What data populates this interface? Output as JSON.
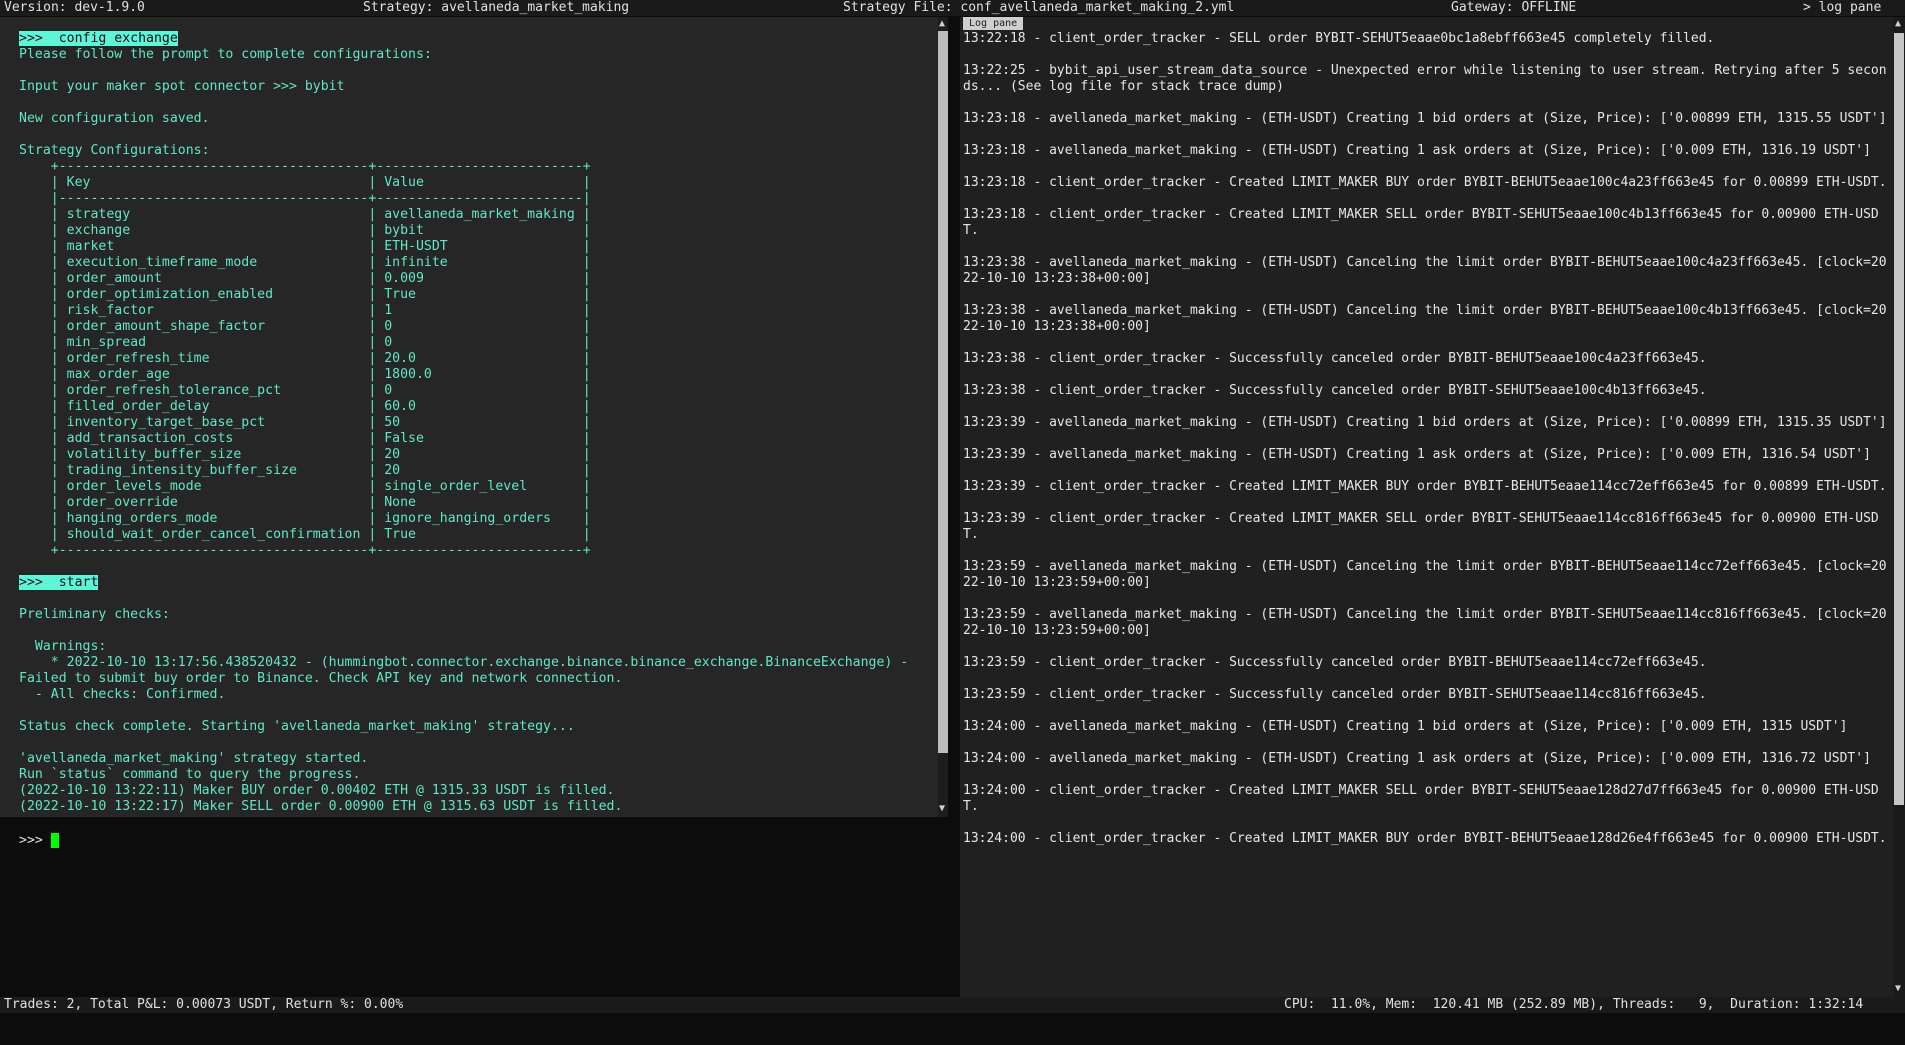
{
  "top_bar": {
    "version": "Version: dev-1.9.0",
    "strategy": "Strategy: avellaneda_market_making",
    "strategy_file": "Strategy File: conf_avellaneda_market_making_2.yml",
    "gateway": "Gateway: OFFLINE",
    "log_pane": "> log pane"
  },
  "output": [
    {
      "text": ">>>  config exchange",
      "cmd": true
    },
    {
      "text": "Please follow the prompt to complete configurations:"
    },
    {
      "text": ""
    },
    {
      "text": "Input your maker spot connector >>> bybit"
    },
    {
      "text": ""
    },
    {
      "text": "New configuration saved."
    },
    {
      "text": ""
    },
    {
      "text": "Strategy Configurations:"
    },
    {
      "text": "    +---------------------------------------+--------------------------+"
    },
    {
      "text": "    | Key                                   | Value                    |"
    },
    {
      "text": "    |---------------------------------------+--------------------------|"
    },
    {
      "text": "    | strategy                              | avellaneda_market_making |"
    },
    {
      "text": "    | exchange                              | bybit                    |"
    },
    {
      "text": "    | market                                | ETH-USDT                 |"
    },
    {
      "text": "    | execution_timeframe_mode              | infinite                 |"
    },
    {
      "text": "    | order_amount                          | 0.009                    |"
    },
    {
      "text": "    | order_optimization_enabled            | True                     |"
    },
    {
      "text": "    | risk_factor                           | 1                        |"
    },
    {
      "text": "    | order_amount_shape_factor             | 0                        |"
    },
    {
      "text": "    | min_spread                            | 0                        |"
    },
    {
      "text": "    | order_refresh_time                    | 20.0                     |"
    },
    {
      "text": "    | max_order_age                         | 1800.0                   |"
    },
    {
      "text": "    | order_refresh_tolerance_pct           | 0                        |"
    },
    {
      "text": "    | filled_order_delay                    | 60.0                     |"
    },
    {
      "text": "    | inventory_target_base_pct             | 50                       |"
    },
    {
      "text": "    | add_transaction_costs                 | False                    |"
    },
    {
      "text": "    | volatility_buffer_size                | 20                       |"
    },
    {
      "text": "    | trading_intensity_buffer_size         | 20                       |"
    },
    {
      "text": "    | order_levels_mode                     | single_order_level       |"
    },
    {
      "text": "    | order_override                        | None                     |"
    },
    {
      "text": "    | hanging_orders_mode                   | ignore_hanging_orders    |"
    },
    {
      "text": "    | should_wait_order_cancel_confirmation | True                     |"
    },
    {
      "text": "    +---------------------------------------+--------------------------+"
    },
    {
      "text": ""
    },
    {
      "text": ">>>  start",
      "cmd": true
    },
    {
      "text": ""
    },
    {
      "text": "Preliminary checks:"
    },
    {
      "text": ""
    },
    {
      "text": "  Warnings:"
    },
    {
      "text": "    * 2022-10-10 13:17:56.438520432 - (hummingbot.connector.exchange.binance.binance_exchange.BinanceExchange) -"
    },
    {
      "text": "Failed to submit buy order to Binance. Check API key and network connection."
    },
    {
      "text": "  - All checks: Confirmed."
    },
    {
      "text": ""
    },
    {
      "text": "Status check complete. Starting 'avellaneda_market_making' strategy..."
    },
    {
      "text": ""
    },
    {
      "text": "'avellaneda_market_making' strategy started."
    },
    {
      "text": "Run `status` command to query the progress."
    },
    {
      "text": "(2022-10-10 13:22:11) Maker BUY order 0.00402 ETH @ 1315.33 USDT is filled."
    },
    {
      "text": "(2022-10-10 13:22:17) Maker SELL order 0.00900 ETH @ 1315.63 USDT is filled."
    }
  ],
  "input": {
    "prompt": ">>> "
  },
  "log_pane": {
    "title": "Log pane",
    "entries": [
      "13:22:18 - client_order_tracker - SELL order BYBIT-SEHUT5eaae0bc1a8ebff663e45 completely filled.",
      "13:22:25 - bybit_api_user_stream_data_source - Unexpected error while listening to user stream. Retrying after 5 seconds... (See log file for stack trace dump)",
      "13:23:18 - avellaneda_market_making - (ETH-USDT) Creating 1 bid orders at (Size, Price): ['0.00899 ETH, 1315.55 USDT']",
      "13:23:18 - avellaneda_market_making - (ETH-USDT) Creating 1 ask orders at (Size, Price): ['0.009 ETH, 1316.19 USDT']",
      "13:23:18 - client_order_tracker - Created LIMIT_MAKER BUY order BYBIT-BEHUT5eaae100c4a23ff663e45 for 0.00899 ETH-USDT.",
      "13:23:18 - client_order_tracker - Created LIMIT_MAKER SELL order BYBIT-SEHUT5eaae100c4b13ff663e45 for 0.00900 ETH-USDT.",
      "13:23:38 - avellaneda_market_making - (ETH-USDT) Canceling the limit order BYBIT-BEHUT5eaae100c4a23ff663e45. [clock=2022-10-10 13:23:38+00:00]",
      "13:23:38 - avellaneda_market_making - (ETH-USDT) Canceling the limit order BYBIT-BEHUT5eaae100c4b13ff663e45. [clock=2022-10-10 13:23:38+00:00]",
      "13:23:38 - client_order_tracker - Successfully canceled order BYBIT-BEHUT5eaae100c4a23ff663e45.",
      "13:23:38 - client_order_tracker - Successfully canceled order BYBIT-SEHUT5eaae100c4b13ff663e45.",
      "13:23:39 - avellaneda_market_making - (ETH-USDT) Creating 1 bid orders at (Size, Price): ['0.00899 ETH, 1315.35 USDT']",
      "13:23:39 - avellaneda_market_making - (ETH-USDT) Creating 1 ask orders at (Size, Price): ['0.009 ETH, 1316.54 USDT']",
      "13:23:39 - client_order_tracker - Created LIMIT_MAKER BUY order BYBIT-BEHUT5eaae114cc72eff663e45 for 0.00899 ETH-USDT.",
      "13:23:39 - client_order_tracker - Created LIMIT_MAKER SELL order BYBIT-SEHUT5eaae114cc816ff663e45 for 0.00900 ETH-USDT.",
      "13:23:59 - avellaneda_market_making - (ETH-USDT) Canceling the limit order BYBIT-BEHUT5eaae114cc72eff663e45. [clock=2022-10-10 13:23:59+00:00]",
      "13:23:59 - avellaneda_market_making - (ETH-USDT) Canceling the limit order BYBIT-SEHUT5eaae114cc816ff663e45. [clock=2022-10-10 13:23:59+00:00]",
      "13:23:59 - client_order_tracker - Successfully canceled order BYBIT-BEHUT5eaae114cc72eff663e45.",
      "13:23:59 - client_order_tracker - Successfully canceled order BYBIT-SEHUT5eaae114cc816ff663e45.",
      "13:24:00 - avellaneda_market_making - (ETH-USDT) Creating 1 bid orders at (Size, Price): ['0.009 ETH, 1315 USDT']",
      "13:24:00 - avellaneda_market_making - (ETH-USDT) Creating 1 ask orders at (Size, Price): ['0.009 ETH, 1316.72 USDT']",
      "13:24:00 - client_order_tracker - Created LIMIT_MAKER SELL order BYBIT-SEHUT5eaae128d27d7ff663e45 for 0.00900 ETH-USDT.",
      "13:24:00 - client_order_tracker - Created LIMIT_MAKER BUY order BYBIT-BEHUT5eaae128d26e4ff663e45 for 0.00900 ETH-USDT."
    ]
  },
  "status_bar": {
    "trades": "Trades: 2, Total P&L: 0.00073 USDT, Return %: 0.00%",
    "system": "CPU:  11.0%, Mem:  120.41 MB (252.89 MB), Threads:   9,  Duration: 1:32:14"
  },
  "icons": {
    "scroll_up": "up-arrow-icon",
    "scroll_down": "down-arrow-icon"
  }
}
